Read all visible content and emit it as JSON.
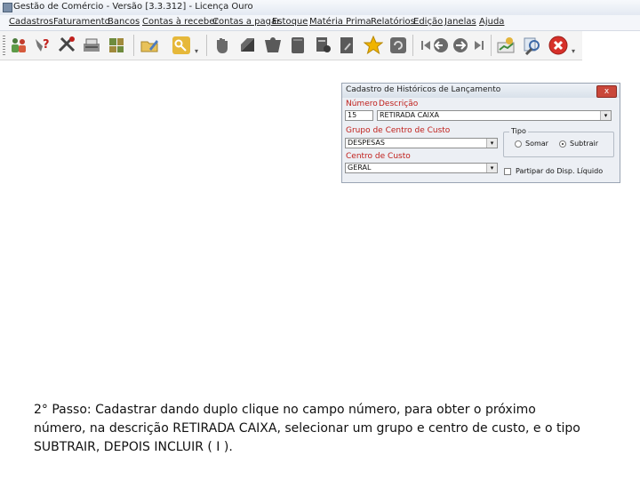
{
  "window": {
    "title": "Gestão de Comércio - Versão [3.3.312] - Licença Ouro"
  },
  "menu": [
    "Cadastros",
    "Faturamento",
    "Bancos",
    "Contas à receber",
    "Contas a pagar",
    "Estoque",
    "Matéria Prima",
    "Relatórios",
    "Edição",
    "Janelas",
    "Ajuda"
  ],
  "toolbar": {
    "icons": [
      "customers-icon",
      "help-question-icon",
      "tools-icon",
      "cash-register-icon",
      "calculator-icon",
      "folder-edit-icon",
      "key-icon",
      "hand-icon",
      "note-icon",
      "card-icon",
      "document-icon",
      "doc-user-icon",
      "doc-arrow-icon",
      "star-icon",
      "refresh-icon",
      "first-icon",
      "back-icon",
      "forward-icon",
      "last-icon",
      "chart-money-icon",
      "search-icon",
      "close-app-icon"
    ]
  },
  "dialog": {
    "title": "Cadastro de Históricos de Lançamento",
    "close_label": "x",
    "numero_label": "Número",
    "descricao_label": "Descrição",
    "numero_value": "15",
    "descricao_value": "RETIRADA CAIXA",
    "grupo_label": "Grupo de Centro de Custo",
    "grupo_value": "DESPESAS",
    "centro_label": "Centro de Custo",
    "centro_value": "GERAL",
    "tipo_label": "Tipo",
    "somar_label": "Somar",
    "subtrair_label": "Subtrair",
    "participa_label": "Partipar do Disp. Líquido"
  },
  "instruction": {
    "text": "2° Passo: Cadastrar dando duplo clique no campo número, para obter o próximo número, na descrição RETIRADA CAIXA, selecionar um grupo e centro de custo, e o tipo SUBTRAIR, DEPOIS INCLUIR ( I )."
  },
  "colors": {
    "red_label": "#c0201c",
    "close_red": "#c9473a",
    "star_gold": "#f0b400"
  }
}
